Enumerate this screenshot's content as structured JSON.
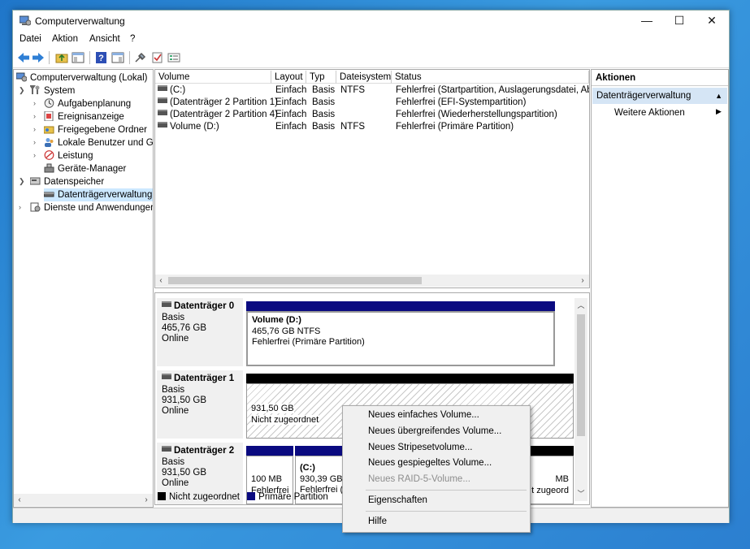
{
  "window": {
    "title": "Computerverwaltung",
    "controls": [
      "—",
      "☐",
      "✕"
    ]
  },
  "menu": [
    "Datei",
    "Aktion",
    "Ansicht",
    "?"
  ],
  "tree": {
    "root": "Computerverwaltung (Lokal)",
    "system": "System",
    "aufgaben": "Aufgabenplanung",
    "ereignis": "Ereignisanzeige",
    "freigaben": "Freigegebene Ordner",
    "benutzer": "Lokale Benutzer und Gr",
    "leistung": "Leistung",
    "geraete": "Geräte-Manager",
    "datenspeicher": "Datenspeicher",
    "datentraeger": "Datenträgerverwaltung",
    "dienste": "Dienste und Anwendungen"
  },
  "volumes": {
    "headers": [
      "Volume",
      "Layout",
      "Typ",
      "Dateisystem",
      "Status"
    ],
    "rows": [
      [
        "(C:)",
        "Einfach",
        "Basis",
        "NTFS",
        "Fehlerfrei (Startpartition, Auslagerungsdatei, Abstu"
      ],
      [
        "(Datenträger 2 Partition 1)",
        "Einfach",
        "Basis",
        "",
        "Fehlerfrei (EFI-Systempartition)"
      ],
      [
        "(Datenträger 2 Partition 4)",
        "Einfach",
        "Basis",
        "",
        "Fehlerfrei (Wiederherstellungspartition)"
      ],
      [
        "Volume (D:)",
        "Einfach",
        "Basis",
        "NTFS",
        "Fehlerfrei (Primäre Partition)"
      ]
    ]
  },
  "disks": {
    "d0": {
      "name": "Datenträger 0",
      "type": "Basis",
      "size": "465,76 GB",
      "state": "Online",
      "part_title": "Volume  (D:)",
      "part_size": "465,76 GB NTFS",
      "part_status": "Fehlerfrei (Primäre Partition)"
    },
    "d1": {
      "name": "Datenträger 1",
      "type": "Basis",
      "size": "931,50 GB",
      "state": "Online",
      "part_size": "931,50 GB",
      "part_status": "Nicht zugeordnet"
    },
    "d2": {
      "name": "Datenträger 2",
      "type": "Basis",
      "size": "931,50 GB",
      "state": "Online",
      "p1_size": "100 MB",
      "p1_status": "Fehlerfrei",
      "p2_title": "(C:)",
      "p2_size": "930,39 GB N",
      "p2_status": "Fehlerfrei (S",
      "p3_size": "MB",
      "p3_status": "t zugeord"
    }
  },
  "legend": {
    "unalloc": "Nicht zugeordnet",
    "primary": "Primäre Partition"
  },
  "actions": {
    "header": "Aktionen",
    "section": "Datenträgerverwaltung",
    "more": "Weitere Aktionen"
  },
  "context_menu": {
    "simple": "Neues einfaches Volume...",
    "spanned": "Neues übergreifendes Volume...",
    "striped": "Neues Stripesetvolume...",
    "mirrored": "Neues gespiegeltes Volume...",
    "raid5": "Neues RAID-5-Volume...",
    "properties": "Eigenschaften",
    "help": "Hilfe"
  },
  "colors": {
    "primary_partition": "#0a0a80",
    "unallocated": "#000000",
    "selection": "#cce8ff",
    "action_section": "#d5e5f5"
  }
}
